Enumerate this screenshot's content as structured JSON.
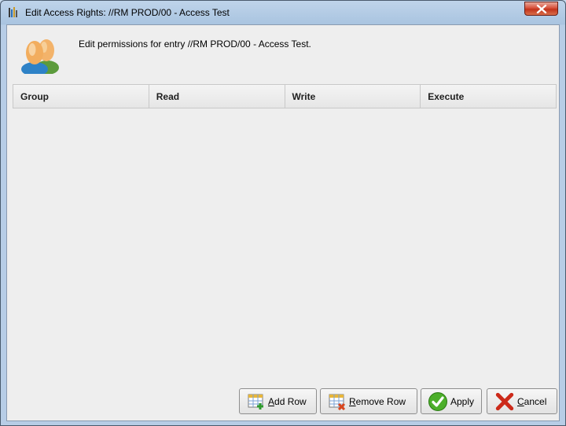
{
  "window": {
    "title": "Edit Access Rights: //RM PROD/00 - Access Test"
  },
  "header": {
    "description": "Edit permissions for entry //RM PROD/00 - Access Test."
  },
  "table": {
    "columns": [
      "Group",
      "Read",
      "Write",
      "Execute"
    ],
    "rows": []
  },
  "buttons": {
    "add_row": {
      "mnemonic": "A",
      "rest": "dd Row"
    },
    "remove_row": {
      "mnemonic": "R",
      "rest": "emove Row"
    },
    "apply": {
      "label": "Apply"
    },
    "cancel": {
      "mnemonic": "C",
      "rest": "ancel"
    }
  },
  "colors": {
    "client_background": "#eeeeee",
    "close_button": "#c2331b",
    "apply_check": "#4caf2a",
    "cancel_x": "#cc2a1a"
  }
}
